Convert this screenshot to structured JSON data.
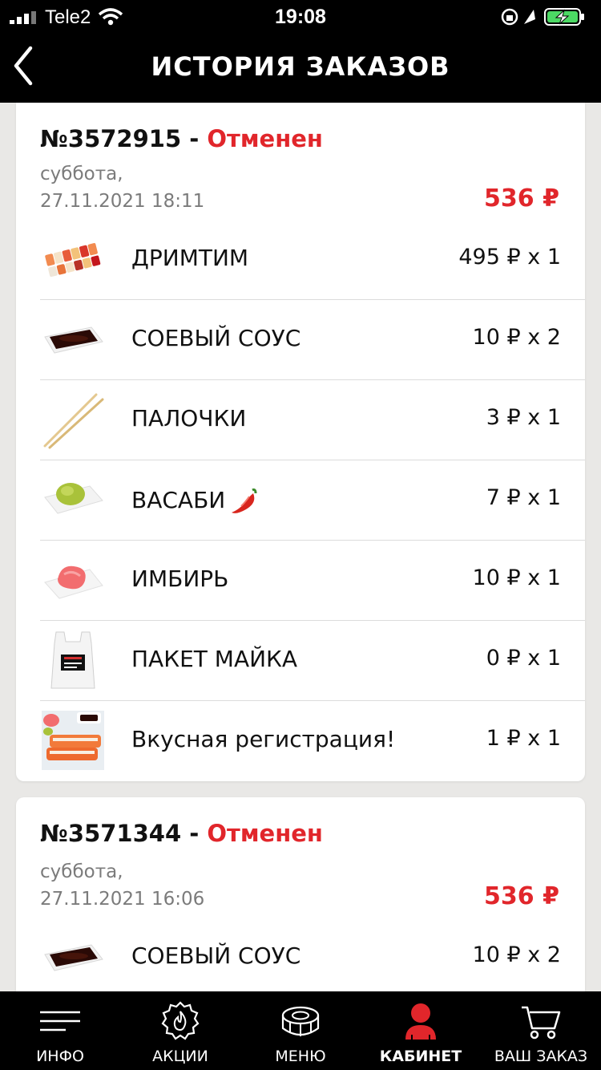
{
  "status_bar": {
    "carrier": "Tele2",
    "time": "19:08"
  },
  "nav": {
    "title": "ИСТОРИЯ ЗАКАЗОВ"
  },
  "orders": [
    {
      "number": "№3572915",
      "separator": " - ",
      "status": "Отменен",
      "day": "суббота,",
      "datetime": "27.11.2021 18:11",
      "total": "536 ₽",
      "items": [
        {
          "name": "ДРИМТИМ",
          "price": "495 ₽ x 1",
          "image": "sushi-set"
        },
        {
          "name": "СОЕВЫЙ СОУС",
          "price": "10 ₽ x 2",
          "image": "soy-sauce"
        },
        {
          "name": "ПАЛОЧКИ",
          "price": "3 ₽ x 1",
          "image": "chopsticks"
        },
        {
          "name": "ВАСАБИ",
          "price": "7 ₽ x 1",
          "image": "wasabi"
        },
        {
          "name": "ИМБИРЬ",
          "price": "10 ₽ x 1",
          "image": "ginger"
        },
        {
          "name": "ПАКЕТ МАЙКА",
          "price": "0 ₽ x 1",
          "image": "bag"
        },
        {
          "name": "Вкусная регистрация!",
          "price": "1 ₽ x 1",
          "image": "rolls"
        }
      ]
    },
    {
      "number": "№3571344",
      "separator": " - ",
      "status": "Отменен",
      "day": "суббота,",
      "datetime": "27.11.2021 16:06",
      "total": "536 ₽",
      "items": [
        {
          "name": "СОЕВЫЙ СОУС",
          "price": "10 ₽ x 2",
          "image": "soy-sauce"
        }
      ]
    }
  ],
  "tabbar": {
    "items": [
      {
        "label": "ИНФО",
        "icon": "menu-lines-icon"
      },
      {
        "label": "АКЦИИ",
        "icon": "flame-badge-icon"
      },
      {
        "label": "МЕНЮ",
        "icon": "sushi-icon"
      },
      {
        "label": "КАБИНЕТ",
        "icon": "user-icon",
        "active": true
      },
      {
        "label": "ВАШ ЗАКАЗ",
        "icon": "cart-icon"
      }
    ]
  },
  "colors": {
    "accent": "#e1262b",
    "bar": "#000000",
    "background": "#e9e8e6"
  }
}
